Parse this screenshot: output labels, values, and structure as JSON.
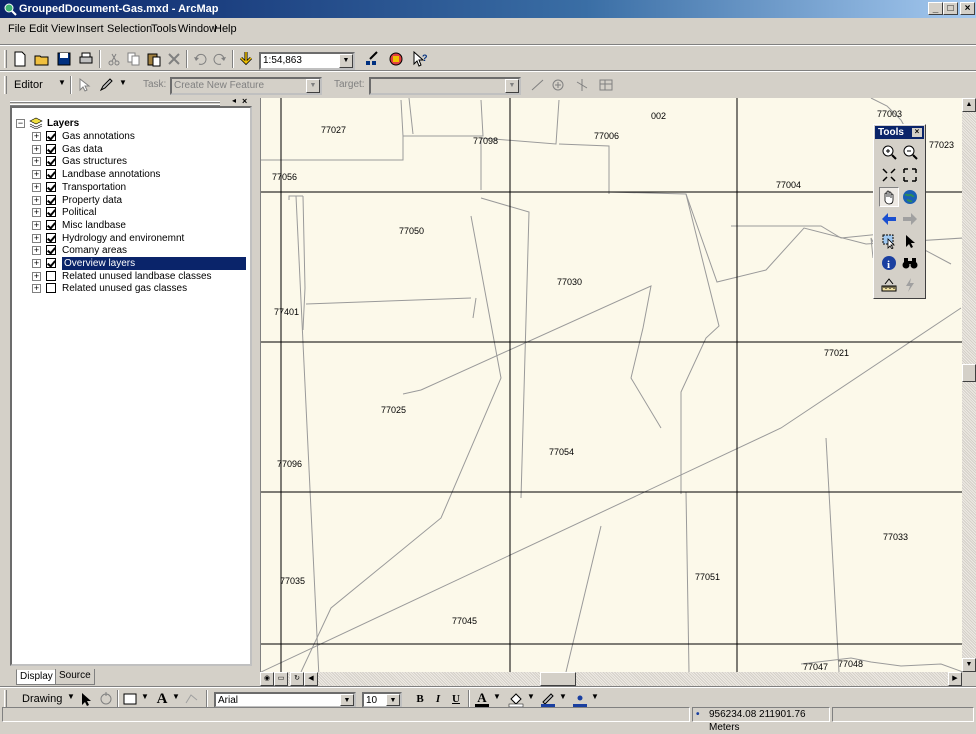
{
  "window": {
    "title": "GroupedDocument-Gas.mxd - ArcMap",
    "controls": {
      "minimize": "_",
      "maximize": "□",
      "close": "×"
    }
  },
  "menu": [
    "File",
    "Edit",
    "View",
    "Insert",
    "Selection",
    "Tools",
    "Window",
    "Help"
  ],
  "standard_toolbar": {
    "scale_value": "1:54,863"
  },
  "editor_toolbar": {
    "editor_label": "Editor",
    "task_label": "Task:",
    "task_value": "Create New Feature",
    "target_label": "Target:",
    "target_value": ""
  },
  "toc": {
    "root": "Layers",
    "layers": [
      {
        "label": "Gas annotations",
        "checked": true
      },
      {
        "label": "Gas data",
        "checked": true
      },
      {
        "label": "Gas structures",
        "checked": true
      },
      {
        "label": "Landbase annotations",
        "checked": true
      },
      {
        "label": "Transportation",
        "checked": true
      },
      {
        "label": "Property data",
        "checked": true
      },
      {
        "label": "Political",
        "checked": true
      },
      {
        "label": "Misc landbase",
        "checked": true
      },
      {
        "label": "Hydrology and environemnt",
        "checked": true
      },
      {
        "label": "Comany areas",
        "checked": true
      },
      {
        "label": "Overview layers",
        "checked": true,
        "selected": true
      },
      {
        "label": "Related unused landbase classes",
        "checked": false
      },
      {
        "label": "Related unused gas classes",
        "checked": false
      }
    ],
    "tabs": [
      "Display",
      "Source"
    ]
  },
  "map": {
    "parcel_labels": [
      "77027",
      "77098",
      "77006",
      "002",
      "77003",
      "77023",
      "77056",
      "77004",
      "77050",
      "77030",
      "77401",
      "77021",
      "77025",
      "77054",
      "77096",
      "77033",
      "77051",
      "77035",
      "77045",
      "77047",
      "77048"
    ]
  },
  "tools_window": {
    "title": "Tools",
    "tools": [
      "zoom-in",
      "zoom-out",
      "fixed-zoom-in",
      "fixed-zoom-out",
      "pan",
      "full-extent",
      "back",
      "forward",
      "select-elements",
      "select-features",
      "identify",
      "find",
      "measure",
      "hyperlink"
    ]
  },
  "drawing_toolbar": {
    "drawing_label": "Drawing",
    "font_name": "Arial",
    "font_size": "10",
    "bold": "B",
    "italic": "I",
    "underline": "U",
    "text_color_letter": "A"
  },
  "status_bar": {
    "coordinates": "956234.08  211901.76 Meters"
  },
  "colors": {
    "titlebar": "#0a246a",
    "map_background": "#fcf9ea",
    "selection": "#0a246a"
  }
}
